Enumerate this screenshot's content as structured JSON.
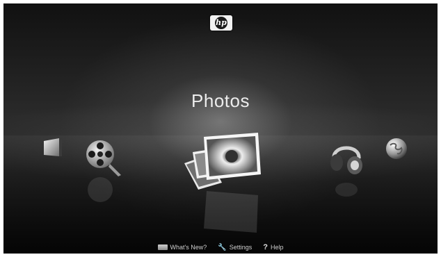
{
  "title": "Photos",
  "logo": {
    "text": "hp"
  },
  "menu": [
    {
      "id": "tv",
      "icon": "tv-icon"
    },
    {
      "id": "video",
      "icon": "film-reel-icon"
    },
    {
      "id": "photos",
      "icon": "photos-icon"
    },
    {
      "id": "music",
      "icon": "headphones-icon"
    },
    {
      "id": "internet",
      "icon": "globe-icon"
    }
  ],
  "footer": {
    "whats_new": "What's New?",
    "settings": "Settings",
    "help": "Help",
    "help_glyph": "?"
  }
}
